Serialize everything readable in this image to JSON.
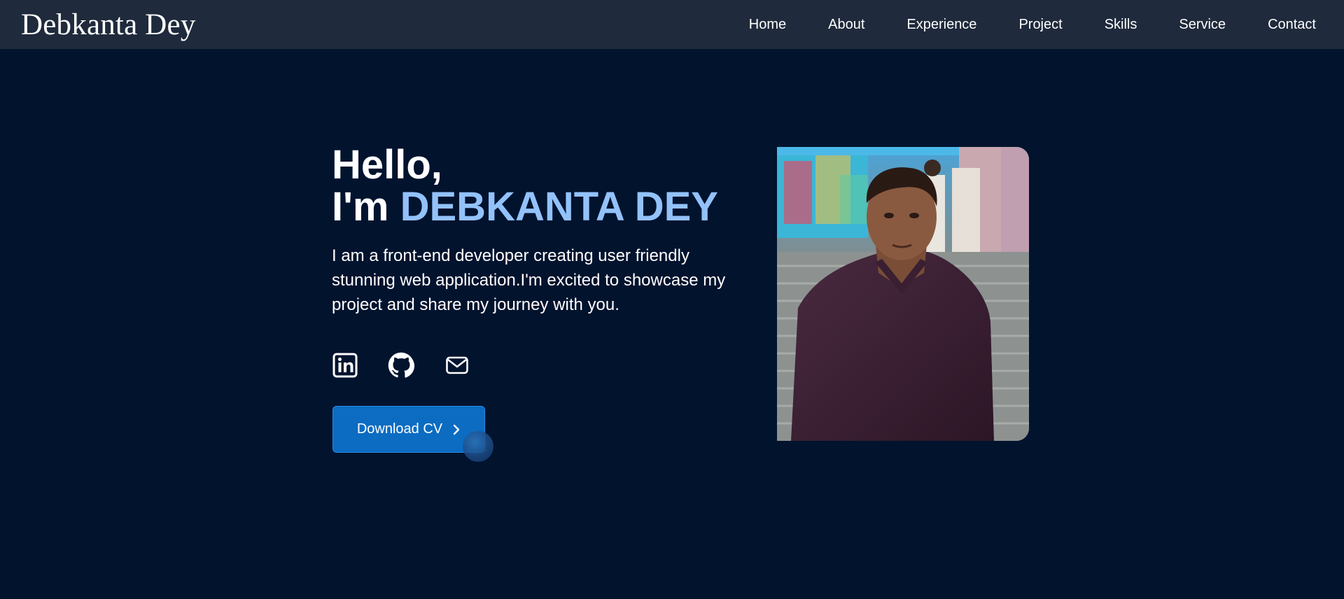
{
  "nav": {
    "brand": "Debkanta Dey",
    "links": [
      "Home",
      "About",
      "Experience",
      "Project",
      "Skills",
      "Service",
      "Contact"
    ]
  },
  "hero": {
    "greeting": "Hello,",
    "name_prefix": "I'm",
    "name": "DEBKANTA DEY",
    "bio": "I am a front-end developer creating user friendly stunning web application.I'm excited to showcase my project and share my journey with you.",
    "cv_button": "Download CV"
  },
  "socials": [
    "linkedin-icon",
    "github-icon",
    "mail-icon"
  ],
  "colors": {
    "background": "#02132e",
    "navbar": "#1f2a3c",
    "accent": "#93c2fa",
    "button": "#0b6cc2"
  }
}
